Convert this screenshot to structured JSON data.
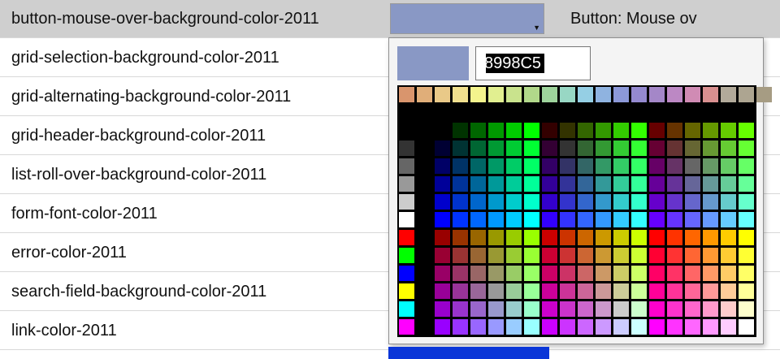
{
  "rows": [
    {
      "name": "button-mouse-over-background-color-2011",
      "selected": true
    },
    {
      "name": "grid-selection-background-color-2011"
    },
    {
      "name": "grid-alternating-background-color-2011"
    },
    {
      "name": "grid-header-background-color-2011"
    },
    {
      "name": "list-roll-over-background-color-2011"
    },
    {
      "name": "form-font-color-2011"
    },
    {
      "name": "error-color-2011"
    },
    {
      "name": "search-field-background-color-2011"
    },
    {
      "name": "link-color-2011"
    }
  ],
  "selected_row": {
    "swatch_color": "#8998C5",
    "description": "Button: Mouse ov",
    "dropdown_icon": "triangle-down"
  },
  "below_swatch_color": "#0a36d8",
  "picker": {
    "preview_color": "#8998C5",
    "hex_value": "8998C5",
    "top_row": [
      "#d9956d",
      "#e0ae79",
      "#e9c988",
      "#f1e08f",
      "#f4f48d",
      "#e1ef90",
      "#c9e38d",
      "#b1d88a",
      "#9ed49c",
      "#98d7c4",
      "#95cfe4",
      "#8fb3e0",
      "#8c98d8",
      "#9489cf",
      "#a487c8",
      "#bc88c4",
      "#d08bb4",
      "#d99090",
      "#b2aa9a",
      "#ada591",
      "#a69c83"
    ],
    "left_col_colors": [
      "#000000",
      "#000000",
      "#333333",
      "#666666",
      "#999999",
      "#cccccc",
      "#ffffff",
      "#ff0000",
      "#00ff00",
      "#0000ff",
      "#ffff00",
      "#00ffff",
      "#ff00ff"
    ]
  }
}
